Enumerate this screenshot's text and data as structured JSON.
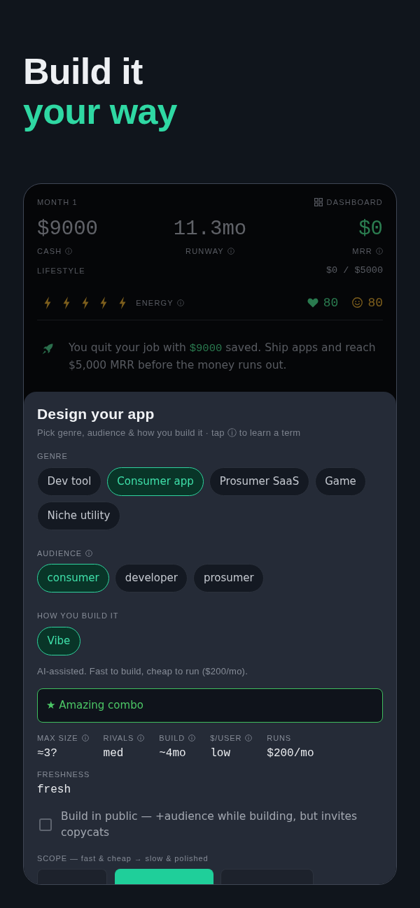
{
  "hero": {
    "title": "Build it",
    "accent": "your way"
  },
  "dashboard": {
    "month": "MONTH 1",
    "link": "DASHBOARD",
    "stats": [
      {
        "value": "$9000",
        "label": "CASH",
        "info": true,
        "color": "#606268"
      },
      {
        "value": "11.3mo",
        "label": "RUNWAY",
        "info": true,
        "color": "#606268"
      },
      {
        "value": "$0",
        "label": "MRR",
        "info": true,
        "color": "#2b7d50"
      }
    ],
    "lifestyle": {
      "label": "LIFESTYLE",
      "value": "$0 / $5000"
    },
    "energy": {
      "label": "ENERGY",
      "info": true,
      "bolts": [
        {
          "filled": true
        },
        {
          "filled": true
        },
        {
          "filled": true
        },
        {
          "filled": true
        },
        {
          "filled": true
        }
      ]
    },
    "vitals": [
      {
        "kind": "health",
        "value": "80",
        "color": "#2a7a4f"
      },
      {
        "kind": "mood",
        "value": "80",
        "color": "#7d5e1c"
      }
    ],
    "intro": "You quit your job with **$9000** saved. Ship apps and reach $5,000 MRR before the money runs out."
  },
  "sheet": {
    "title": "Design your app",
    "subtitle": "Pick genre, audience & how you build it · tap ⓘ to learn a term",
    "sections": [
      {
        "label": "GENRE",
        "info": false,
        "options": [
          {
            "label": "Dev tool",
            "selected": false
          },
          {
            "label": "Consumer app",
            "selected": true
          },
          {
            "label": "Prosumer SaaS",
            "selected": false
          },
          {
            "label": "Game",
            "selected": false
          },
          {
            "label": "Niche utility",
            "selected": false
          }
        ]
      },
      {
        "label": "AUDIENCE",
        "info": true,
        "options": [
          {
            "label": "consumer",
            "selected": true
          },
          {
            "label": "developer",
            "selected": false
          },
          {
            "label": "prosumer",
            "selected": false
          }
        ]
      },
      {
        "label": "HOW YOU BUILD IT",
        "info": false,
        "options": [
          {
            "label": "Vibe",
            "selected": true
          }
        ],
        "description": "AI-assisted. Fast to build, cheap to run ($200/mo)."
      }
    ],
    "combo": "★ Amazing combo",
    "stats": [
      {
        "label": "MAX SIZE",
        "info": true,
        "value": "≈3?"
      },
      {
        "label": "RIVALS",
        "info": true,
        "value": "med"
      },
      {
        "label": "BUILD",
        "info": true,
        "value": "~4mo"
      },
      {
        "label": "$/USER",
        "info": true,
        "value": "low"
      },
      {
        "label": "RUNS",
        "info": false,
        "value": "$200/mo"
      }
    ],
    "freshness": {
      "label": "FRESHNESS",
      "value": "fresh"
    },
    "build_in_public": {
      "label": "Build in public — +audience while building, but invites copycats",
      "checked": false
    },
    "scope": {
      "label": "SCOPE — fast & cheap → slow & polished",
      "options": [
        {
          "selected": false
        },
        {
          "selected": true
        },
        {
          "selected": false
        }
      ]
    }
  }
}
